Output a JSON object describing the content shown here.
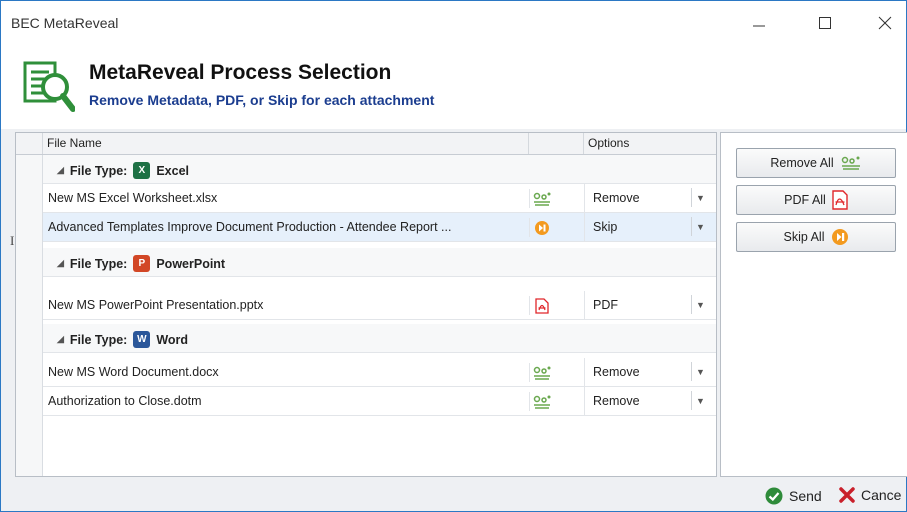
{
  "window": {
    "title": "BEC MetaReveal"
  },
  "header": {
    "title": "MetaReveal Process Selection",
    "subtitle": "Remove Metadata, PDF, or Skip for each attachment"
  },
  "grid": {
    "columns": {
      "file_name": "File Name",
      "options": "Options"
    },
    "groups": [
      {
        "label": "File Type:",
        "type": "Excel",
        "rows": [
          {
            "file": "New MS Excel Worksheet.xlsx",
            "icon": "remove-metadata-icon",
            "option": "Remove"
          },
          {
            "file": "Advanced Templates Improve Document Production - Attendee Report ...",
            "icon": "skip-icon",
            "option": "Skip"
          }
        ]
      },
      {
        "label": "File Type:",
        "type": "PowerPoint",
        "rows": [
          {
            "file": "New MS PowerPoint Presentation.pptx",
            "icon": "pdf-icon",
            "option": "PDF"
          }
        ]
      },
      {
        "label": "File Type:",
        "type": "Word",
        "rows": [
          {
            "file": "New MS Word Document.docx",
            "icon": "remove-metadata-icon",
            "option": "Remove"
          },
          {
            "file": "Authorization to Close.dotm",
            "icon": "remove-metadata-icon",
            "option": "Remove"
          }
        ]
      }
    ]
  },
  "actions": {
    "remove_all": "Remove All",
    "pdf_all": "PDF All",
    "skip_all": "Skip All"
  },
  "footer": {
    "send": "Send",
    "cancel": "Cance"
  },
  "colors": {
    "excel": "#1e7145",
    "powerpoint": "#d24726",
    "word": "#2b579a",
    "skip": "#f39a1f",
    "pdf": "#e0262a",
    "accent": "#1b3d8f",
    "logo": "#2f8f3a"
  }
}
